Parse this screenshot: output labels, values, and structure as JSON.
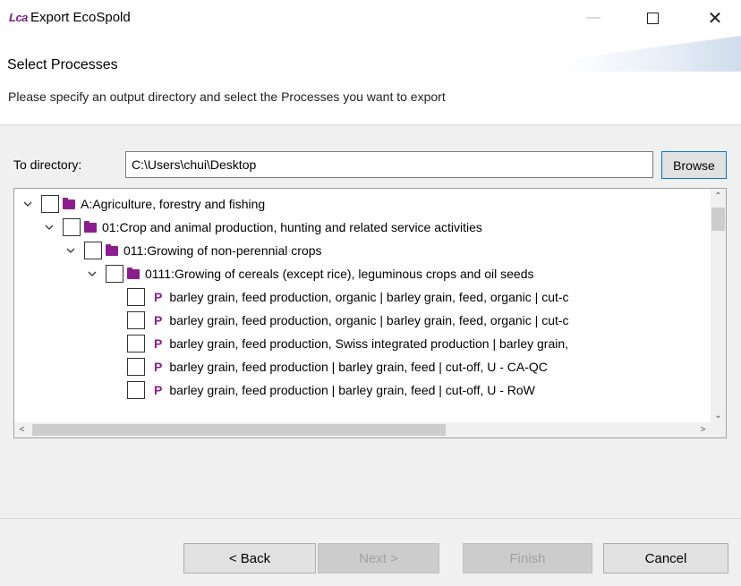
{
  "window": {
    "app_icon_text": "Lca",
    "title": "Export EcoSpold",
    "minimize_glyph": "—",
    "close_glyph": "✕"
  },
  "header": {
    "heading": "Select Processes",
    "description": "Please specify an output directory and select the Processes you want to export"
  },
  "directory": {
    "label": "To directory:",
    "value": "C:\\Users\\chui\\Desktop",
    "browse_label": "Browse"
  },
  "tree": {
    "rows": [
      {
        "type": "folder",
        "level": 0,
        "expanded": true,
        "checked": false,
        "label": "A:Agriculture, forestry and fishing"
      },
      {
        "type": "folder",
        "level": 1,
        "expanded": true,
        "checked": false,
        "label": "01:Crop and animal production, hunting and related service activities"
      },
      {
        "type": "folder",
        "level": 2,
        "expanded": true,
        "checked": false,
        "label": "011:Growing of non-perennial crops"
      },
      {
        "type": "folder",
        "level": 3,
        "expanded": true,
        "checked": false,
        "label": "0111:Growing of cereals (except rice), leguminous crops and oil seeds"
      },
      {
        "type": "process",
        "level": 4,
        "checked": false,
        "icon": "P",
        "label": "barley grain, feed production, organic | barley grain, feed, organic | cut-c"
      },
      {
        "type": "process",
        "level": 4,
        "checked": false,
        "icon": "P",
        "label": "barley grain, feed production, organic | barley grain, feed, organic | cut-c"
      },
      {
        "type": "process",
        "level": 4,
        "checked": false,
        "icon": "P",
        "label": "barley grain, feed production, Swiss integrated production | barley grain,"
      },
      {
        "type": "process",
        "level": 4,
        "checked": false,
        "icon": "P",
        "label": "barley grain, feed production | barley grain, feed | cut-off, U - CA-QC"
      },
      {
        "type": "process",
        "level": 4,
        "checked": false,
        "icon": "P",
        "label": "barley grain, feed production | barley grain, feed | cut-off, U - RoW"
      }
    ],
    "scroll_glyphs": {
      "up": "⌃",
      "down": "⌄",
      "left": "<",
      "right": ">"
    },
    "vertical_scroll_fraction": 0.0,
    "horizontal_scroll_fraction": 0.0
  },
  "footer": {
    "back_label": "< Back",
    "next_label": "Next >",
    "finish_label": "Finish",
    "cancel_label": "Cancel",
    "next_enabled": false,
    "finish_enabled": false
  },
  "colors": {
    "folder": "#8a1e8f",
    "process_icon": "#8a1e8f",
    "focus_border": "#0078d7"
  }
}
